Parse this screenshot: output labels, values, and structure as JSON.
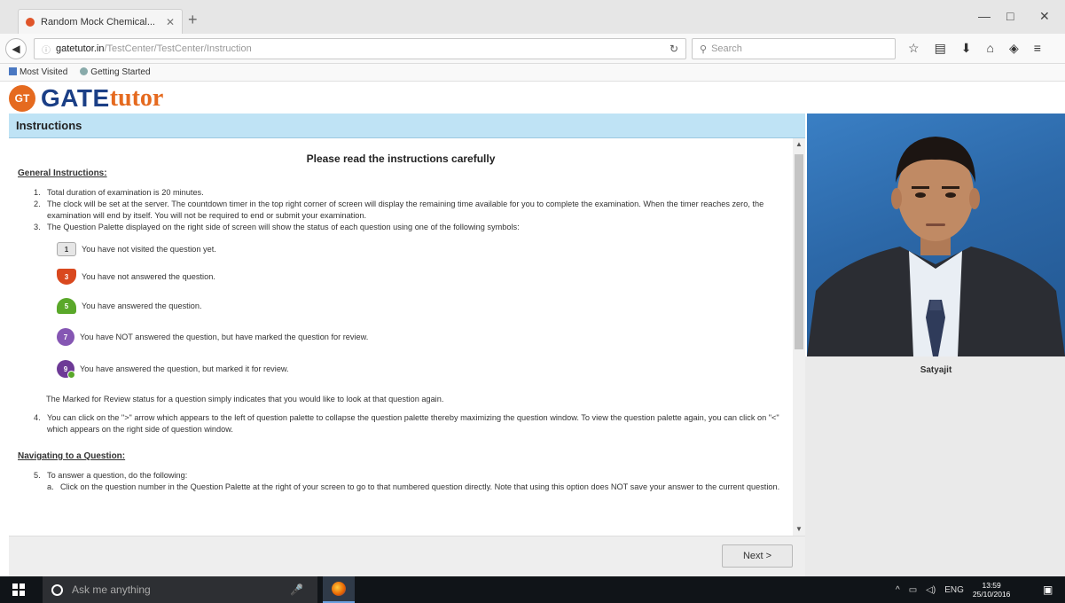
{
  "browser": {
    "tab_title": "Random Mock Chemical...",
    "tab_close": "✕",
    "new_tab": "+",
    "url_host": "gatetutor.in",
    "url_path": "/TestCenter/TestCenter/Instruction",
    "search_placeholder": "Search",
    "bookmarks": [
      "Most Visited",
      "Getting Started"
    ],
    "window_controls": {
      "minimize": "—",
      "maximize": "□",
      "close": "✕"
    }
  },
  "logo": {
    "badge": "GT",
    "part1": "GATE",
    "part2": "tutor"
  },
  "instructions": {
    "header": "Instructions",
    "read_title": "Please read the instructions carefully",
    "general_heading": "General Instructions:",
    "items": [
      {
        "num": "1.",
        "text": "Total duration of examination is 20 minutes."
      },
      {
        "num": "2.",
        "text": "The clock will be set at the server. The countdown timer in the top right corner of screen will display the remaining time available for you to complete the examination. When the timer reaches zero, the examination will end by itself. You will not be required to end or submit your examination."
      },
      {
        "num": "3.",
        "text": "The Question Palette displayed on the right side of screen will show the status of each question using one of the following symbols:"
      }
    ],
    "symbols": [
      {
        "badge": "1",
        "style": "grey",
        "text": "You have not visited the question yet."
      },
      {
        "badge": "3",
        "style": "red",
        "text": "You have not answered the question."
      },
      {
        "badge": "5",
        "style": "green",
        "text": "You have answered the question."
      },
      {
        "badge": "7",
        "style": "purple",
        "text": "You have NOT answered the question, but have marked the question for review."
      },
      {
        "badge": "9",
        "style": "purple2",
        "text": "You have answered the question, but marked it for review."
      }
    ],
    "marked_note": "The Marked for Review status for a question simply indicates that you would like to look at that question again.",
    "item4": {
      "num": "4.",
      "text": "You can click on the \">\" arrow which appears to the left of question palette to collapse the question palette thereby maximizing the question window. To view the question palette again, you can click on \"<\" which appears on the right side of question window."
    },
    "nav_heading": "Navigating to a Question:",
    "item5": {
      "num": "5.",
      "text": "To answer a question, do the following:"
    },
    "item5a": {
      "num": "a.",
      "text": "Click on the question number in the Question Palette at the right of your screen to go to that numbered question directly. Note that using this option does NOT save your answer to the current question."
    }
  },
  "candidate": {
    "name": "Satyajit"
  },
  "next_button": "Next >",
  "taskbar": {
    "search_placeholder": "Ask me anything",
    "lang": "ENG",
    "time": "13:59",
    "date": "25/10/2016"
  }
}
